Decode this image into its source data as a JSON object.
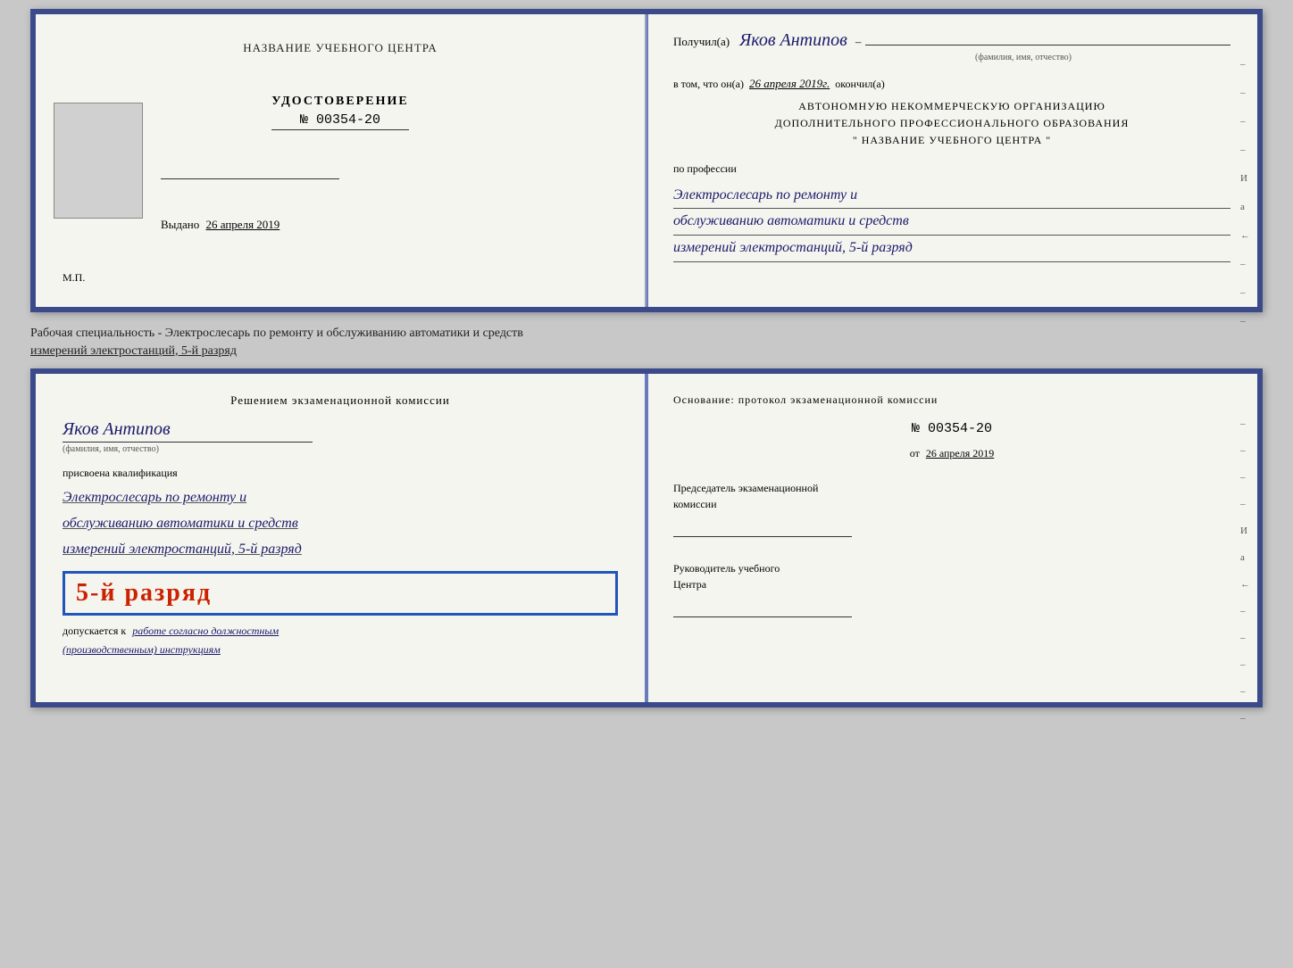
{
  "top_left": {
    "org_name": "НАЗВАНИЕ УЧЕБНОГО ЦЕНТРА",
    "cert_label": "УДОСТОВЕРЕНИЕ",
    "cert_number": "№ 00354-20",
    "issued_label": "Выдано",
    "issued_date": "26 апреля 2019",
    "stamp_label": "М.П."
  },
  "top_right": {
    "received_label": "Получил(а)",
    "recipient_name": "Яков Антипов",
    "fio_sublabel": "(фамилия, имя, отчество)",
    "in_that_label": "в том, что он(а)",
    "completion_date": "26 апреля 2019г.",
    "completed_label": "окончил(а)",
    "org_line1": "АВТОНОМНУЮ НЕКОММЕРЧЕСКУЮ ОРГАНИЗАЦИЮ",
    "org_line2": "ДОПОЛНИТЕЛЬНОГО ПРОФЕССИОНАЛЬНОГО ОБРАЗОВАНИЯ",
    "org_line3": "\"    НАЗВАНИЕ УЧЕБНОГО ЦЕНТРА    \"",
    "profession_label": "по профессии",
    "profession_handwritten1": "Электрослесарь по ремонту и",
    "profession_handwritten2": "обслуживанию автоматики и средств",
    "profession_handwritten3": "измерений электростанций, 5-й разряд",
    "side_marks": [
      "–",
      "–",
      "–",
      "–",
      "И",
      "а",
      "←",
      "–",
      "–",
      "–"
    ]
  },
  "specialty_text": "Рабочая специальность - Электрослесарь по ремонту и обслуживанию автоматики и средств",
  "specialty_text2": "измерений электростанций, 5-й разряд",
  "bottom_left": {
    "commission_line1": "Решением  экзаменационной  комиссии",
    "name_handwritten": "Яков Антипов",
    "fio_sublabel": "(фамилия, имя, отчество)",
    "assigned_label": "присвоена квалификация",
    "qual_handwritten1": "Электрослесарь по ремонту и",
    "qual_handwritten2": "обслуживанию автоматики и средств",
    "qual_handwritten3": "измерений электростанций, 5-й разряд",
    "rank_badge": "5-й разряд",
    "allowed_label": "допускается к",
    "allowed_handwritten": "работе согласно должностным",
    "allowed_handwritten2": "(производственным) инструкциям"
  },
  "bottom_right": {
    "basis_label": "Основание:  протокол  экзаменационной  комиссии",
    "protocol_number": "№  00354-20",
    "protocol_date_prefix": "от",
    "protocol_date": "26 апреля 2019",
    "chairman_line1": "Председатель экзаменационной",
    "chairman_line2": "комиссии",
    "director_line1": "Руководитель учебного",
    "director_line2": "Центра",
    "side_marks": [
      "–",
      "–",
      "–",
      "–",
      "И",
      "а",
      "←",
      "–",
      "–",
      "–",
      "–",
      "–"
    ]
  }
}
